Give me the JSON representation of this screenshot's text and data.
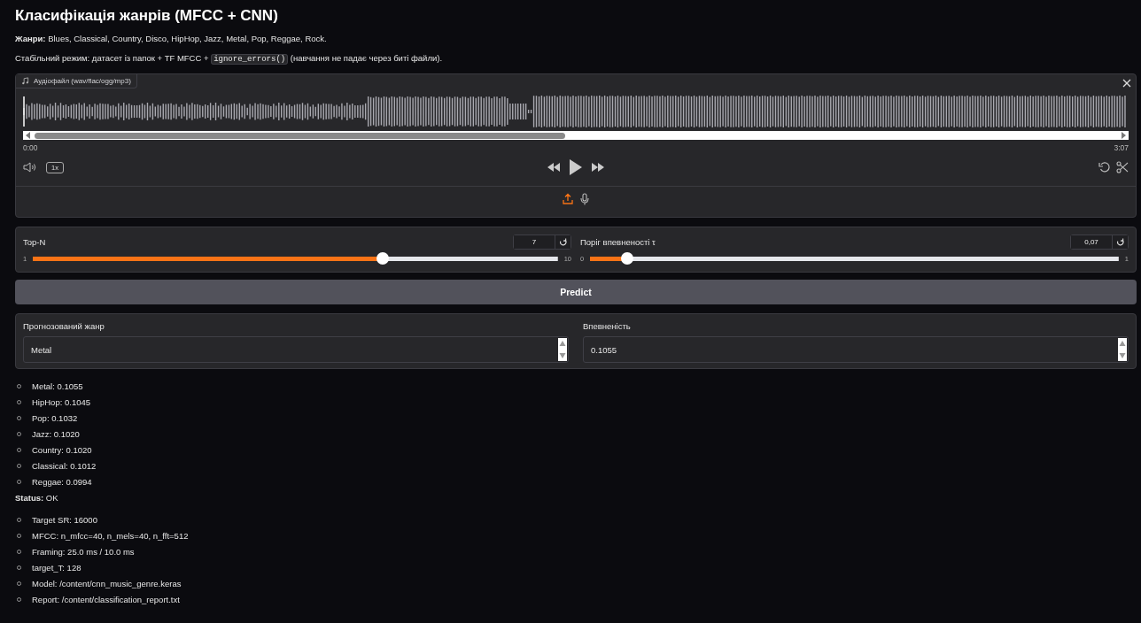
{
  "title": "Класифікація жанрів (MFCC + CNN)",
  "genres_line": "**Жанри:** Blues, Classical, Country, Disco, HipHop, Jazz, Metal, Pop, Reggae, Rock.",
  "mode_line": {
    "before": "Стабільний режим: датасет із папок + TF MFCC + ",
    "code": "ignore_errors()",
    "after": " (навчання не падає через биті файли)."
  },
  "audio": {
    "label": "Аудіофайл (wav/flac/ogg/mp3)",
    "time_start": "0:00",
    "time_end": "3:07",
    "speed": "1x"
  },
  "sliders": [
    {
      "label": "Top-N",
      "value": "7",
      "min": "1",
      "max": "10",
      "level": 0.667
    },
    {
      "label": "Поріг впевненості τ",
      "value": "0,07",
      "min": "0",
      "max": "1",
      "level": 0.07
    }
  ],
  "predict_button": "Predict",
  "outputs": [
    {
      "label": "Прогнозований жанр",
      "value": "Metal"
    },
    {
      "label": "Впевненість",
      "value": "0.1055"
    }
  ],
  "scores": [
    "Metal: 0.1055",
    "HipHop: 0.1045",
    "Pop: 0.1032",
    "Jazz: 0.1020",
    "Country: 0.1020",
    "Classical: 0.1012",
    "Reggae: 0.0994"
  ],
  "status_line": "**Status:** OK",
  "details": [
    "Target SR: 16000",
    "MFCC: n_mfcc=40, n_mels=40, n_fft=512",
    "Framing: 25.0 ms / 10.0 ms",
    "target_T: 128",
    "Model: /content/cnn_music_genre.keras",
    "Report: /content/classification_report.txt"
  ]
}
